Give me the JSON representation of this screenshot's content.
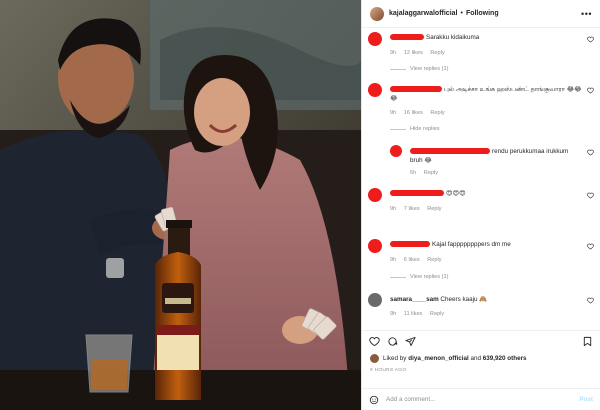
{
  "header": {
    "username": "kajalaggarwalofficial",
    "separator": "•",
    "follow_label": "Following",
    "more_label": "•••"
  },
  "comments": [
    {
      "text": "Sarakku kidaikuma",
      "time": "9h",
      "likes": "12 likes",
      "reply": "Reply",
      "replies_toggle": "View replies (1)"
    },
    {
      "text": "புல் அடிச்சா உங்க ஹஸ்பண்ட் தாங்குவாரா 😂😂😂",
      "time": "9h",
      "likes": "16 likes",
      "reply": "Reply",
      "replies_toggle": "Hide replies"
    },
    {
      "text": "rendu perukkumaa irukkum bruh 😂",
      "time": "6h",
      "likes": "",
      "reply": "Reply"
    },
    {
      "text": "😍😍😍",
      "time": "9h",
      "likes": "7 likes",
      "reply": "Reply"
    },
    {
      "text": "Kajal fappppppppers dm me",
      "time": "9h",
      "likes": "6 likes",
      "reply": "Reply",
      "replies_toggle": "View replies (1)"
    },
    {
      "username": "samara____sam",
      "text": "Cheers kaaju 🙈",
      "time": "9h",
      "likes": "11 likes",
      "reply": "Reply"
    }
  ],
  "likes_line": {
    "prefix": "Liked by",
    "user": "diya_menon_official",
    "conj": "and",
    "count": "639,920 others"
  },
  "time_ago": "9 HOURS AGO",
  "add_comment": {
    "placeholder": "Add a comment...",
    "post_label": "Post"
  },
  "icons": {
    "heart": "heart-icon",
    "comment": "comment-icon",
    "share": "share-icon",
    "save": "bookmark-icon",
    "emoji": "emoji-icon",
    "more": "more-icon"
  },
  "colors": {
    "redaction": "#ef1c1c",
    "meta_gray": "#8e8e8e",
    "post_blue": "#b2dffc"
  }
}
